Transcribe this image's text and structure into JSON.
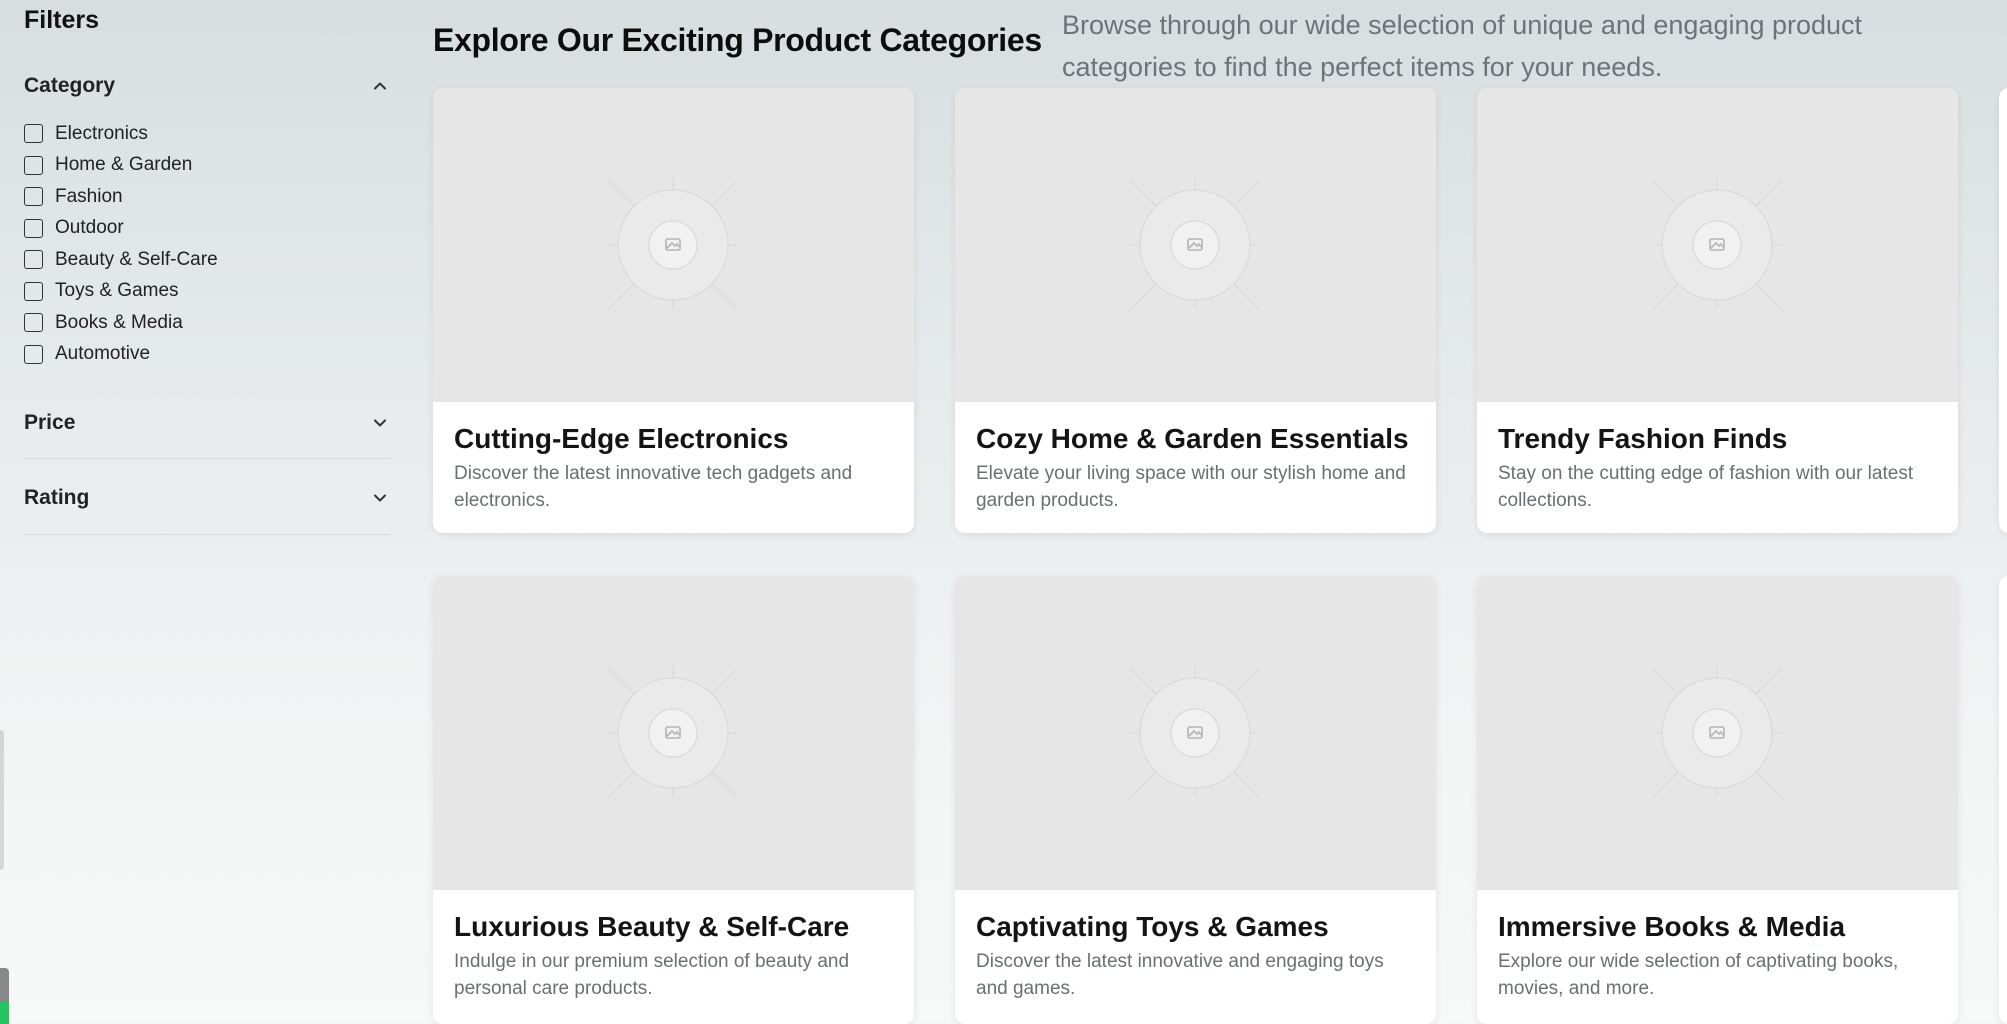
{
  "sidebar": {
    "title": "Filters",
    "sections": {
      "category": {
        "label": "Category",
        "expanded": true,
        "items": [
          {
            "label": "Electronics",
            "checked": false
          },
          {
            "label": "Home & Garden",
            "checked": false
          },
          {
            "label": "Fashion",
            "checked": false
          },
          {
            "label": "Outdoor",
            "checked": false
          },
          {
            "label": "Beauty & Self-Care",
            "checked": false
          },
          {
            "label": "Toys & Games",
            "checked": false
          },
          {
            "label": "Books & Media",
            "checked": false
          },
          {
            "label": "Automotive",
            "checked": false
          }
        ]
      },
      "price": {
        "label": "Price",
        "expanded": false
      },
      "rating": {
        "label": "Rating",
        "expanded": false
      }
    }
  },
  "main": {
    "title": "Explore Our Exciting Product Categories",
    "description": "Browse through our wide selection of unique and engaging product categories to find the perfect items for your needs.",
    "cards": [
      {
        "title": "Cutting-Edge Electronics",
        "description": "Discover the latest innovative tech gadgets and electronics.",
        "image_icon": "image-placeholder-icon"
      },
      {
        "title": "Cozy Home & Garden Essentials",
        "description": "Elevate your living space with our stylish home and garden products.",
        "image_icon": "image-placeholder-icon"
      },
      {
        "title": "Trendy Fashion Finds",
        "description": "Stay on the cutting edge of fashion with our latest collections.",
        "image_icon": "image-placeholder-icon"
      },
      {
        "title": "Luxurious Beauty & Self-Care",
        "description": "Indulge in our premium selection of beauty and personal care products.",
        "image_icon": "image-placeholder-icon"
      },
      {
        "title": "Captivating Toys & Games",
        "description": "Discover the latest innovative and engaging toys and games.",
        "image_icon": "image-placeholder-icon"
      },
      {
        "title": "Immersive Books & Media",
        "description": "Explore our wide selection of captivating books, movies, and more.",
        "image_icon": "image-placeholder-icon"
      }
    ]
  },
  "colors": {
    "title_text": "#0d0d0d",
    "description_text": "#6b7477",
    "card_image_bg": "#e6e6e6",
    "accent_scroll": "#22c55e"
  }
}
